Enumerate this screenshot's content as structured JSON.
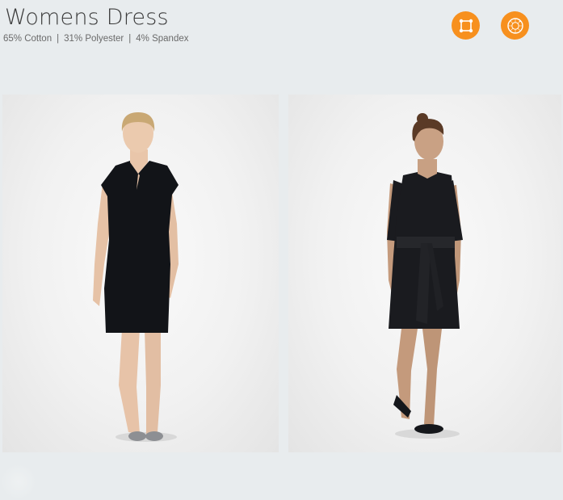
{
  "product": {
    "title": "Womens Dress",
    "materials": [
      "65% Cotton",
      "31% Polyester",
      "4% Spandex"
    ],
    "separator": "|"
  },
  "actions": [
    {
      "name": "measurements",
      "icon": "measure-frame-icon",
      "color": "#f7901e"
    },
    {
      "name": "view-360",
      "icon": "rotate-360-icon",
      "color": "#f7901e"
    }
  ],
  "gallery": [
    {
      "name": "photo-front",
      "description_icon": "model-front-view-image"
    },
    {
      "name": "photo-side",
      "description_icon": "model-belted-dress-image"
    }
  ]
}
